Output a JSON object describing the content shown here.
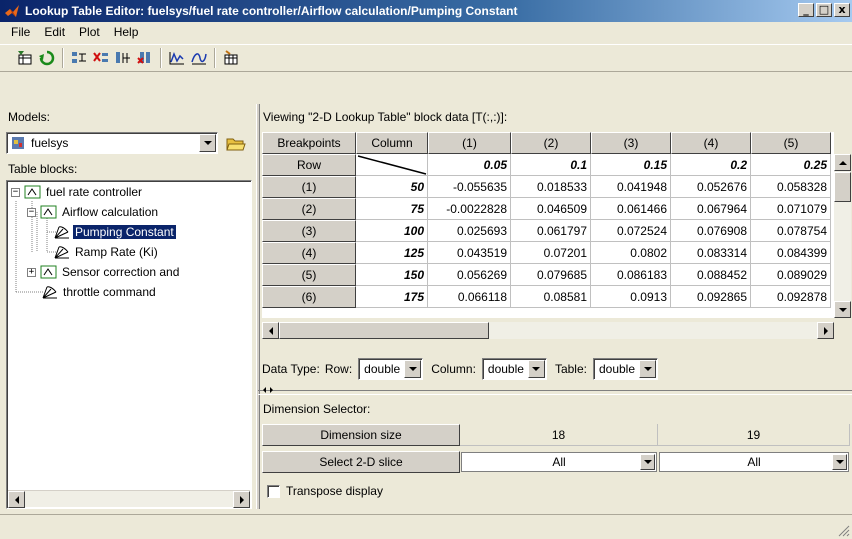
{
  "window": {
    "title": "Lookup Table Editor: fuelsys/fuel rate controller/Airflow calculation/Pumping Constant",
    "minimize": "_",
    "maximize": "□",
    "close": "x"
  },
  "menu": [
    "File",
    "Edit",
    "Plot",
    "Help"
  ],
  "toolbar": {
    "icons": [
      "open-table-icon",
      "refresh-icon",
      "add-row-icon",
      "remove-icon",
      "insert-column-icon",
      "delete-column-icon",
      "line-plot-icon",
      "mesh-plot-icon",
      "table-icon"
    ]
  },
  "models": {
    "label": "Models:",
    "selected": "fuelsys"
  },
  "table_blocks": {
    "label": "Table blocks:",
    "tree": [
      {
        "label": "fuel rate controller",
        "level": 0,
        "expander": "−"
      },
      {
        "label": "Airflow calculation",
        "level": 1,
        "expander": "−"
      },
      {
        "label": "Pumping Constant",
        "level": 2,
        "selected": true
      },
      {
        "label": "Ramp Rate (Ki)",
        "level": 2
      },
      {
        "label": "Sensor correction and",
        "level": 1,
        "expander": "+"
      },
      {
        "label": "throttle command",
        "level": 0
      }
    ]
  },
  "viewing_label": "Viewing \"2-D Lookup Table\" block data [T(:,:)]:",
  "grid": {
    "corner_header": "Breakpoints",
    "column_header": "Column",
    "row_header": "Row",
    "col_headers": [
      "(1)",
      "(2)",
      "(3)",
      "(4)",
      "(5)"
    ],
    "col_breakpoints": [
      "0.05",
      "0.1",
      "0.15",
      "0.2",
      "0.25"
    ],
    "rows": [
      {
        "index": "(1)",
        "bp": "50",
        "values": [
          "-0.055635",
          "0.018533",
          "0.041948",
          "0.052676",
          "0.058328"
        ]
      },
      {
        "index": "(2)",
        "bp": "75",
        "values": [
          "-0.0022828",
          "0.046509",
          "0.061466",
          "0.067964",
          "0.071079"
        ]
      },
      {
        "index": "(3)",
        "bp": "100",
        "values": [
          "0.025693",
          "0.061797",
          "0.072524",
          "0.076908",
          "0.078754"
        ]
      },
      {
        "index": "(4)",
        "bp": "125",
        "values": [
          "0.043519",
          "0.07201",
          "0.0802",
          "0.083314",
          "0.084399"
        ]
      },
      {
        "index": "(5)",
        "bp": "150",
        "values": [
          "0.056269",
          "0.079685",
          "0.086183",
          "0.088452",
          "0.089029"
        ]
      },
      {
        "index": "(6)",
        "bp": "175",
        "values": [
          "0.066118",
          "0.08581",
          "0.0913",
          "0.092865",
          "0.092878"
        ]
      }
    ]
  },
  "datatype": {
    "label": "Data Type:",
    "row_label": "Row:",
    "row_value": "double",
    "column_label": "Column:",
    "column_value": "double",
    "table_label": "Table:",
    "table_value": "double"
  },
  "dimension": {
    "label": "Dimension Selector:",
    "size_label": "Dimension size",
    "size_values": [
      "18",
      "19"
    ],
    "slice_label": "Select 2-D slice",
    "slice_values": [
      "All",
      "All"
    ]
  },
  "transpose_label": "Transpose display"
}
